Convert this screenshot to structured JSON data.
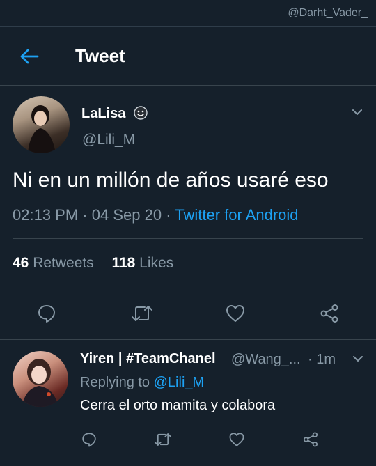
{
  "watermark": "@Darht_Vader_",
  "header": {
    "title": "Tweet"
  },
  "tweet": {
    "author_name": "LaLisa",
    "author_emoji": "☻",
    "author_handle": "@Lili_M",
    "text": "Ni en un millón de años usaré eso",
    "time": "02:13 PM",
    "date": "04 Sep 20",
    "source": "Twitter for Android",
    "retweets_count": "46",
    "retweets_label": "Retweets",
    "likes_count": "118",
    "likes_label": "Likes"
  },
  "reply": {
    "author_name": "Yiren | #TeamChanel",
    "author_handle": "@Wang_...",
    "time": "1m",
    "replying_to_label": "Replying to",
    "replying_to_handle": "@Lili_M",
    "text": "Cerra el orto mamita y colabora"
  },
  "colors": {
    "background": "#15202b",
    "accent": "#1da1f2",
    "secondary_text": "#8899a6",
    "divider": "#38444d"
  },
  "icons": [
    "back-arrow-icon",
    "chevron-down-icon",
    "reply-icon",
    "retweet-icon",
    "like-icon",
    "share-icon",
    "smiley-emoji-icon"
  ]
}
